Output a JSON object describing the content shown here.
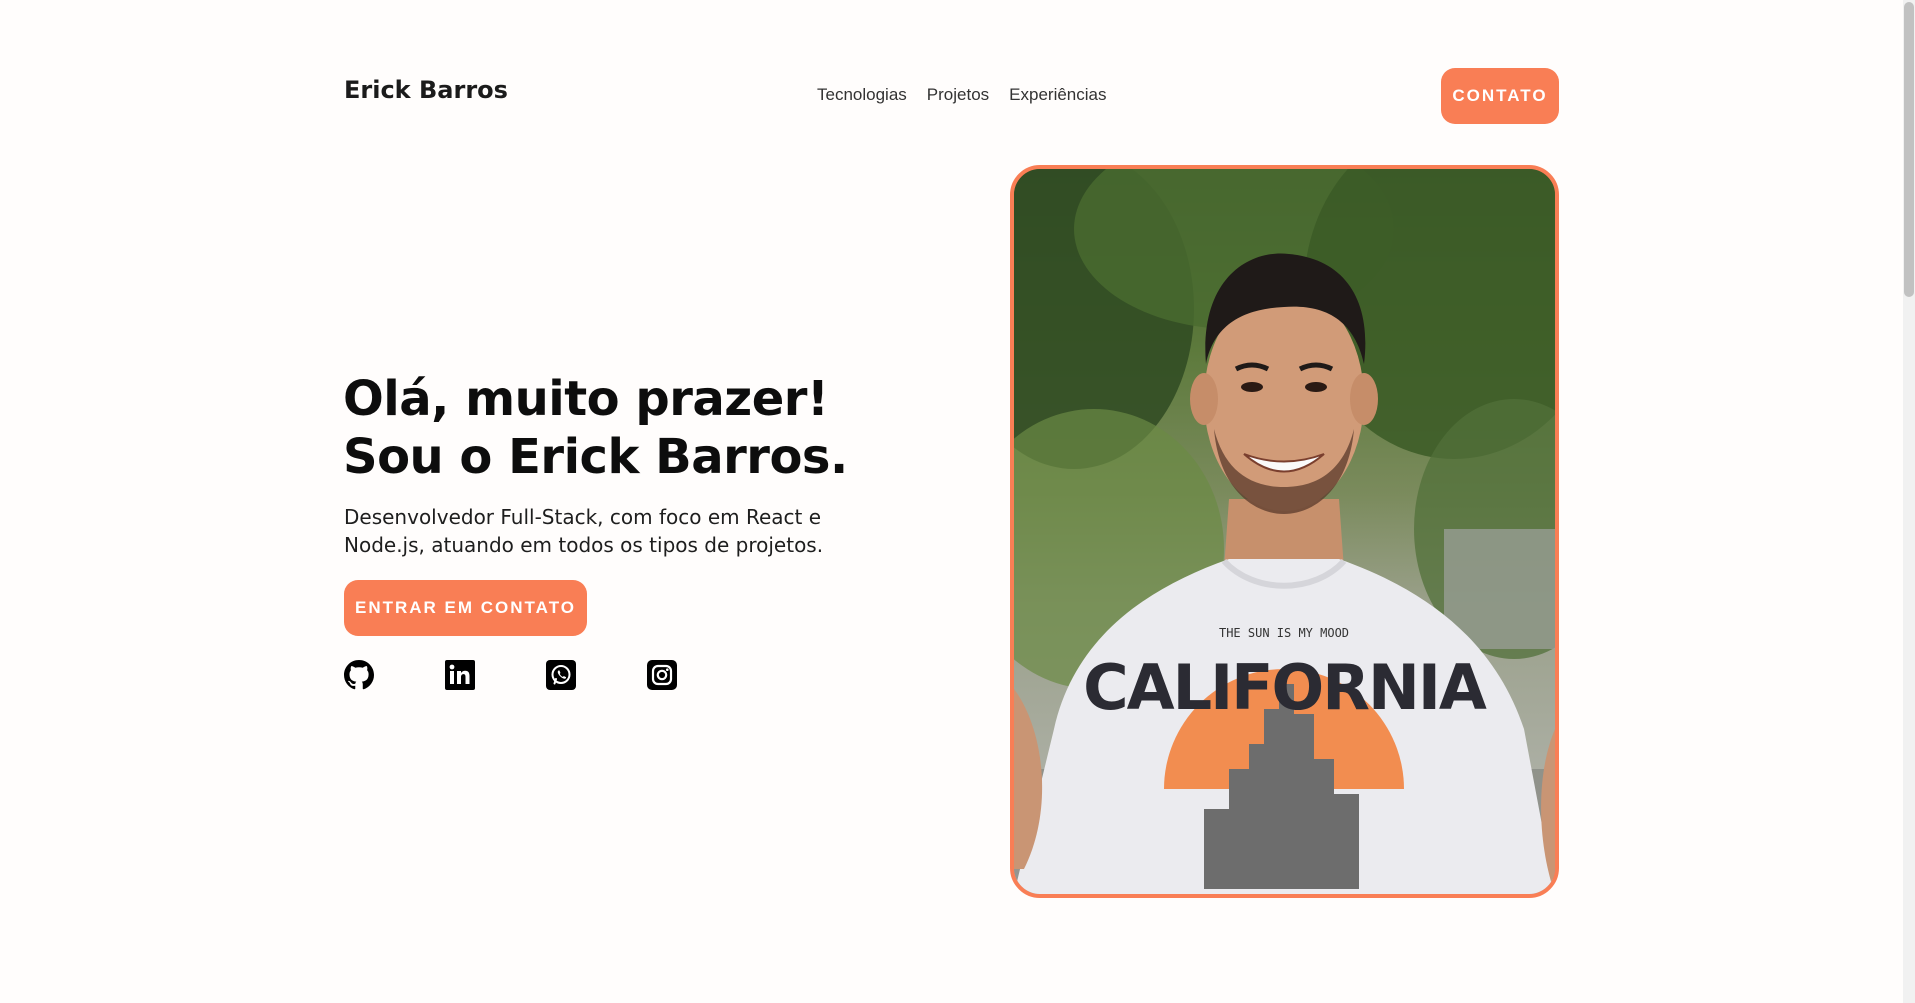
{
  "header": {
    "brand": "Erick Barros",
    "nav": [
      {
        "label": "Tecnologias"
      },
      {
        "label": "Projetos"
      },
      {
        "label": "Experiências"
      }
    ],
    "contact_button": "CONTATO"
  },
  "hero": {
    "title_line1": "Olá, muito prazer!",
    "title_line2": "Sou o Erick Barros.",
    "subtitle": "Desenvolvedor Full-Stack, com foco em React e Node.js, atuando em todos os tipos de projetos.",
    "cta_button": "ENTRAR EM CONTATO",
    "socials": [
      {
        "icon": "github-icon"
      },
      {
        "icon": "linkedin-icon"
      },
      {
        "icon": "whatsapp-icon"
      },
      {
        "icon": "instagram-icon"
      }
    ],
    "photo": {
      "shirt_top_text": "THE SUN IS MY MOOD",
      "shirt_main_text": "CALIFORNIA"
    }
  },
  "colors": {
    "accent": "#f97e55",
    "text": "#0d0d0d",
    "background": "#fffdfc"
  }
}
